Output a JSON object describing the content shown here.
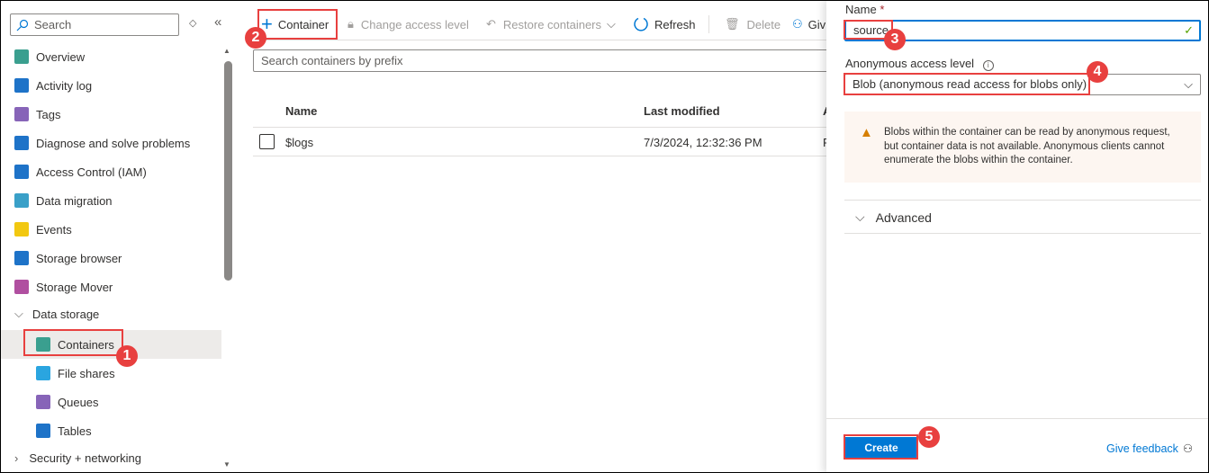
{
  "sidebar": {
    "search_placeholder": "Search",
    "items": [
      {
        "label": "Overview",
        "icon": "overview-icon",
        "color": "#3a9f8f"
      },
      {
        "label": "Activity log",
        "icon": "activity-log-icon",
        "color": "#1e73c8"
      },
      {
        "label": "Tags",
        "icon": "tag-icon",
        "color": "#8764b8"
      },
      {
        "label": "Diagnose and solve problems",
        "icon": "wrench-icon",
        "color": "#1e73c8"
      },
      {
        "label": "Access Control (IAM)",
        "icon": "people-icon",
        "color": "#1e73c8"
      },
      {
        "label": "Data migration",
        "icon": "data-migration-icon",
        "color": "#3aa0c8"
      },
      {
        "label": "Events",
        "icon": "lightning-icon",
        "color": "#f2c811"
      },
      {
        "label": "Storage browser",
        "icon": "storage-browser-icon",
        "color": "#1e73c8"
      },
      {
        "label": "Storage Mover",
        "icon": "storage-mover-icon",
        "color": "#b04fa0"
      }
    ],
    "group": "Data storage",
    "sub_items": [
      {
        "label": "Containers",
        "icon": "containers-icon",
        "color": "#3a9f8f"
      },
      {
        "label": "File shares",
        "icon": "file-shares-icon",
        "color": "#2aa5e0"
      },
      {
        "label": "Queues",
        "icon": "queues-icon",
        "color": "#8764b8"
      },
      {
        "label": "Tables",
        "icon": "tables-icon",
        "color": "#1e73c8"
      }
    ],
    "group2": "Security + networking"
  },
  "toolbar": {
    "container": "Container",
    "change_access": "Change access level",
    "restore": "Restore containers",
    "refresh": "Refresh",
    "delete": "Delete",
    "feedback": "Giv"
  },
  "main": {
    "search_placeholder": "Search containers by prefix",
    "columns": [
      "Name",
      "Last modified",
      "A"
    ],
    "rows": [
      {
        "name": "$logs",
        "modified": "7/3/2024, 12:32:36 PM",
        "access": "P"
      }
    ]
  },
  "panel": {
    "name_label": "Name",
    "required": "*",
    "name_value": "source",
    "access_label": "Anonymous access level",
    "access_value": "Blob (anonymous read access for blobs only)",
    "warning": "Blobs within the container can be read by anonymous request, but container data is not available. Anonymous clients cannot enumerate the blobs within the container.",
    "advanced": "Advanced",
    "create": "Create",
    "give_feedback": "Give feedback"
  },
  "callouts": [
    "1",
    "2",
    "3",
    "4",
    "5"
  ],
  "colors": {
    "accent": "#0078d4",
    "callout": "#e8403f",
    "warning": "#d67f00"
  }
}
